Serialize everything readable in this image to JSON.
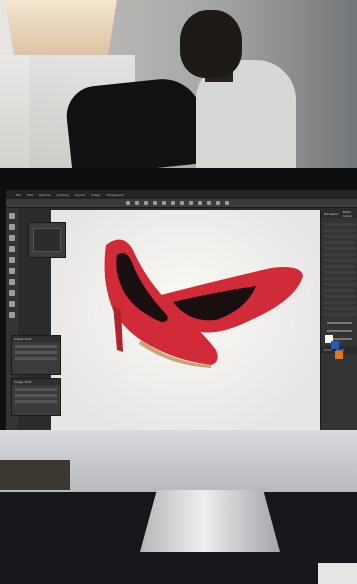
{
  "menu": {
    "items": [
      "File",
      "Edit",
      "Options",
      "Lighting",
      "Layout",
      "Image",
      "Transparent"
    ]
  },
  "panels": {
    "right_tabs": [
      "Navigator",
      "Batch Action"
    ],
    "color_tabs": [
      "Color",
      "Layer"
    ],
    "left_panel_titles": [
      "Adjust Tools",
      "Image Tools"
    ]
  },
  "colors": {
    "shoe_red": "#d12a38",
    "shoe_dark": "#1a0e10",
    "sole_tan": "#caa274"
  }
}
